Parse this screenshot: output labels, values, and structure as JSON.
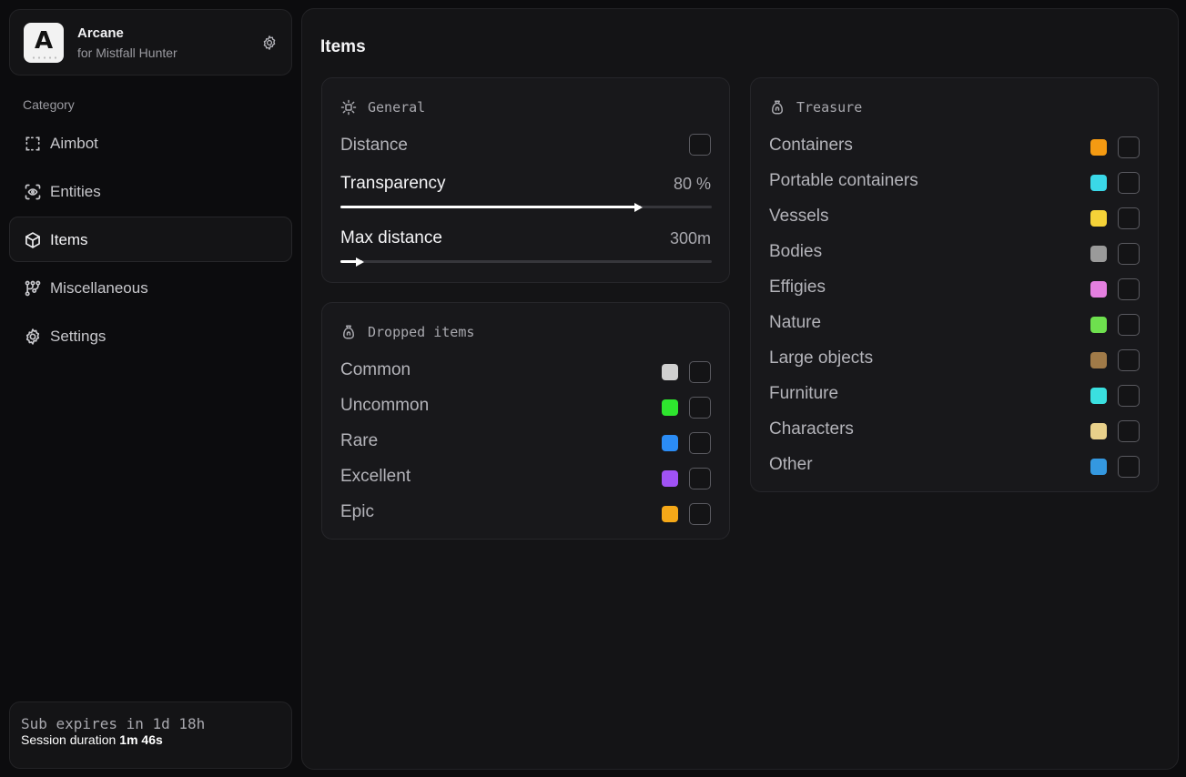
{
  "brand": {
    "name": "Arcane",
    "subtitle": "for Mistfall Hunter",
    "logo_letter": "A"
  },
  "sidebar": {
    "category_label": "Category",
    "items": [
      {
        "label": "Aimbot",
        "icon": "crosshair-frame-icon"
      },
      {
        "label": "Entities",
        "icon": "scan-eye-icon"
      },
      {
        "label": "Items",
        "icon": "box-icon",
        "active": true
      },
      {
        "label": "Miscellaneous",
        "icon": "nodes-icon"
      },
      {
        "label": "Settings",
        "icon": "gear-icon"
      }
    ]
  },
  "footer": {
    "sub_expires": "Sub expires in 1d 18h",
    "session_label": "Session duration",
    "session_value": "1m 46s"
  },
  "main": {
    "title": "Items",
    "general": {
      "title": "General",
      "distance_label": "Distance",
      "transparency": {
        "label": "Transparency",
        "value": "80 %",
        "fraction": 0.81
      },
      "max_distance": {
        "label": "Max distance",
        "value": "300m",
        "fraction": 0.06
      }
    },
    "dropped": {
      "title": "Dropped items",
      "items": [
        {
          "label": "Common",
          "color": "#cfcfcf"
        },
        {
          "label": "Uncommon",
          "color": "#2ee52e"
        },
        {
          "label": "Rare",
          "color": "#2b8cf5"
        },
        {
          "label": "Excellent",
          "color": "#a052f5"
        },
        {
          "label": "Epic",
          "color": "#f5a818"
        }
      ]
    },
    "treasure": {
      "title": "Treasure",
      "items": [
        {
          "label": "Containers",
          "color": "#f59a12"
        },
        {
          "label": "Portable containers",
          "color": "#3ad8e8"
        },
        {
          "label": "Vessels",
          "color": "#f5d238"
        },
        {
          "label": "Bodies",
          "color": "#9a9a9a"
        },
        {
          "label": "Effigies",
          "color": "#e47fe0"
        },
        {
          "label": "Nature",
          "color": "#6ee04e"
        },
        {
          "label": "Large objects",
          "color": "#a07a48"
        },
        {
          "label": "Furniture",
          "color": "#3ae0e0"
        },
        {
          "label": "Characters",
          "color": "#e8d08a"
        },
        {
          "label": "Other",
          "color": "#3498e0"
        }
      ]
    }
  }
}
